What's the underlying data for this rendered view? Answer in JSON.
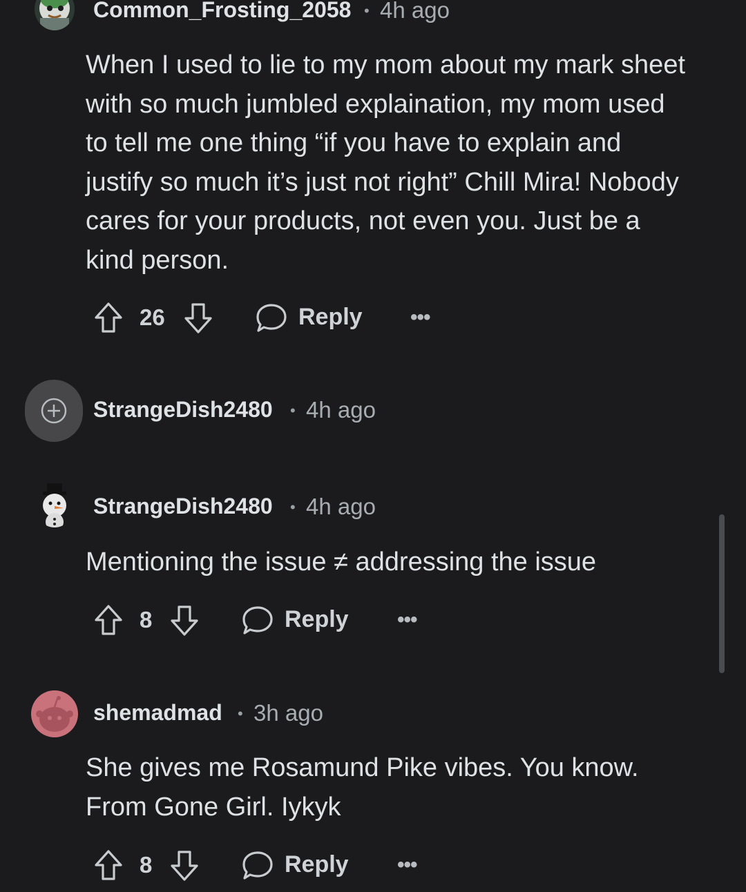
{
  "comments": [
    {
      "username": "Common_Frosting_2058",
      "dot": "•",
      "time": "4h ago",
      "lines": [
        "When I used to lie to my mom about my mark sheet",
        "with so much jumbled explaination, my mom used",
        "to tell me one thing “if you have to explain and",
        "justify so much it’s just not right” Chill Mira! Nobody",
        "cares for your products, not even you. Just be a",
        "kind person."
      ],
      "votes": "26",
      "reply_label": "Reply",
      "more": "•••"
    },
    {
      "collapsed": true,
      "expand_icon": "plus-icon",
      "username": "StrangeDish2480",
      "dot": "•",
      "time": "4h ago"
    },
    {
      "username": "StrangeDish2480",
      "dot": "•",
      "time": "4h ago",
      "lines": [
        "Mentioning the issue ≠ addressing the issue"
      ],
      "votes": "8",
      "reply_label": "Reply",
      "more": "•••"
    },
    {
      "username": "shemadmad",
      "dot": "•",
      "time": "3h ago",
      "lines": [
        "She gives me Rosamund Pike vibes. You know.",
        "From Gone Girl. Iykyk"
      ],
      "votes": "8",
      "reply_label": "Reply",
      "more": "•••"
    }
  ],
  "colors": {
    "background": "#1b1b1d",
    "text": "#dfe2e4",
    "muted": "#a8adb1",
    "avatar_pink": "#c9727c"
  }
}
